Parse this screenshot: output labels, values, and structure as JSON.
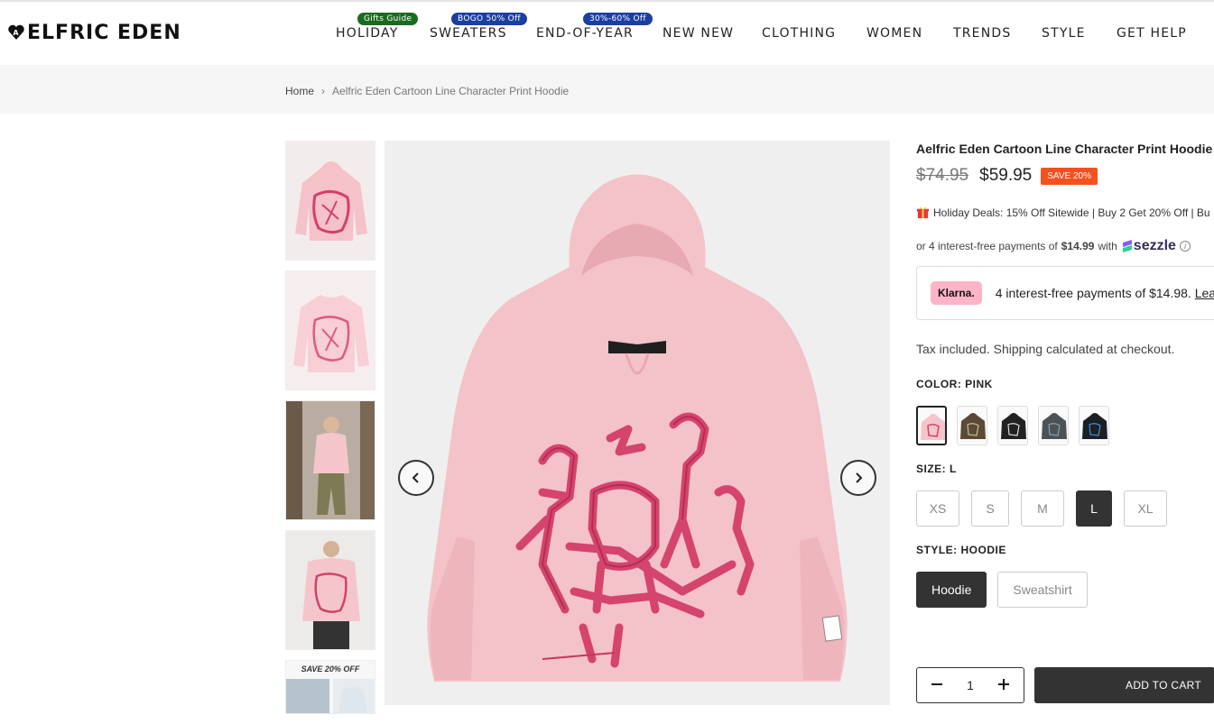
{
  "brand": {
    "name": "ELFRIC EDEN",
    "heart_letter": "A"
  },
  "nav": {
    "items": [
      {
        "label": "HOLIDAY",
        "badge": "Gifts Guide",
        "badge_color": "#1a7a1a"
      },
      {
        "label": "SWEATERS",
        "badge": "BOGO 50% Off",
        "badge_color": "#1a3fa0"
      },
      {
        "label": "END-OF-YEAR",
        "badge": "30%-60% Off",
        "badge_color": "#1a3fa0"
      },
      {
        "label": "NEW NEW"
      },
      {
        "label": "CLOTHING"
      },
      {
        "label": "WOMEN"
      },
      {
        "label": "TRENDS"
      },
      {
        "label": "STYLE"
      },
      {
        "label": "GET HELP"
      }
    ]
  },
  "breadcrumb": {
    "home": "Home",
    "current": "Aelfric Eden Cartoon Line Character Print Hoodie"
  },
  "gallery": {
    "last_thumb_text": "SAVE 20% OFF"
  },
  "product": {
    "title": "Aelfric Eden Cartoon Line Character Print Hoodie",
    "old_price": "$74.95",
    "price": "$59.95",
    "save_badge": "SAVE 20%",
    "deals": "Holiday Deals: 15% Off Sitewide | Buy 2 Get 20% Off | Bu",
    "sezzle_prefix": "or 4 interest-free payments of",
    "sezzle_amount": "$14.99",
    "sezzle_with": "with",
    "sezzle_logo": "sezzle",
    "klarna_logo": "Klarna.",
    "klarna_text": "4 interest-free payments of $14.98.",
    "klarna_link": "Learn more",
    "tax_note": "Tax included. Shipping calculated at checkout.",
    "color_label": "COLOR:",
    "color_value": "PINK",
    "size_label": "SIZE:",
    "size_value": "L",
    "sizes": [
      "XS",
      "S",
      "M",
      "L",
      "XL"
    ],
    "style_label": "STYLE:",
    "style_value": "HOODIE",
    "styles": [
      "Hoodie",
      "Sweatshirt"
    ],
    "quantity": "1",
    "add_to_cart": "ADD TO CART"
  },
  "colors": {
    "pink": "#f4c6cc",
    "print": "#d9446a",
    "swatches": [
      "#f4c6cc",
      "#5a4a36",
      "#222222",
      "#4b5258",
      "#1b2026"
    ]
  }
}
